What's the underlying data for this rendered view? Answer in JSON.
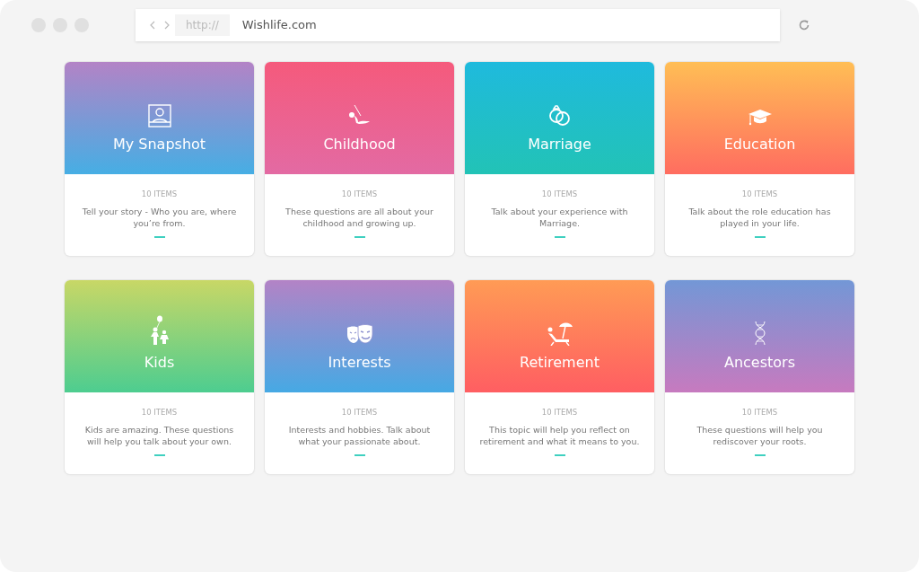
{
  "browser": {
    "protocol": "http://",
    "url": "Wishlife.com"
  },
  "cards": [
    {
      "kind": "portrait",
      "title": "My Snapshot",
      "count": "10 ITEMS",
      "description": "Tell your story - Who you are, where you’re from."
    },
    {
      "kind": "swing",
      "title": "Childhood",
      "count": "10 ITEMS",
      "description": "These questions are all about  your childhood and growing up."
    },
    {
      "kind": "rings",
      "title": "Marriage",
      "count": "10 ITEMS",
      "description": "Talk about your experience with Marriage."
    },
    {
      "kind": "cap",
      "title": "Education",
      "count": "10 ITEMS",
      "description": "Talk about the role education has played in your life."
    },
    {
      "kind": "kids",
      "title": "Kids",
      "count": "10 ITEMS",
      "description": "Kids are amazing. These questions will help you talk about your own."
    },
    {
      "kind": "masks",
      "title": "Interests",
      "count": "10 ITEMS",
      "description": "Interests and hobbies. Talk about what your passionate about."
    },
    {
      "kind": "beach",
      "title": "Retirement",
      "count": "10 ITEMS",
      "description": "This topic will help you reflect on retirement and what it means to you."
    },
    {
      "kind": "dna",
      "title": "Ancestors",
      "count": "10 ITEMS",
      "description": "These questions will help you rediscover your roots."
    }
  ]
}
